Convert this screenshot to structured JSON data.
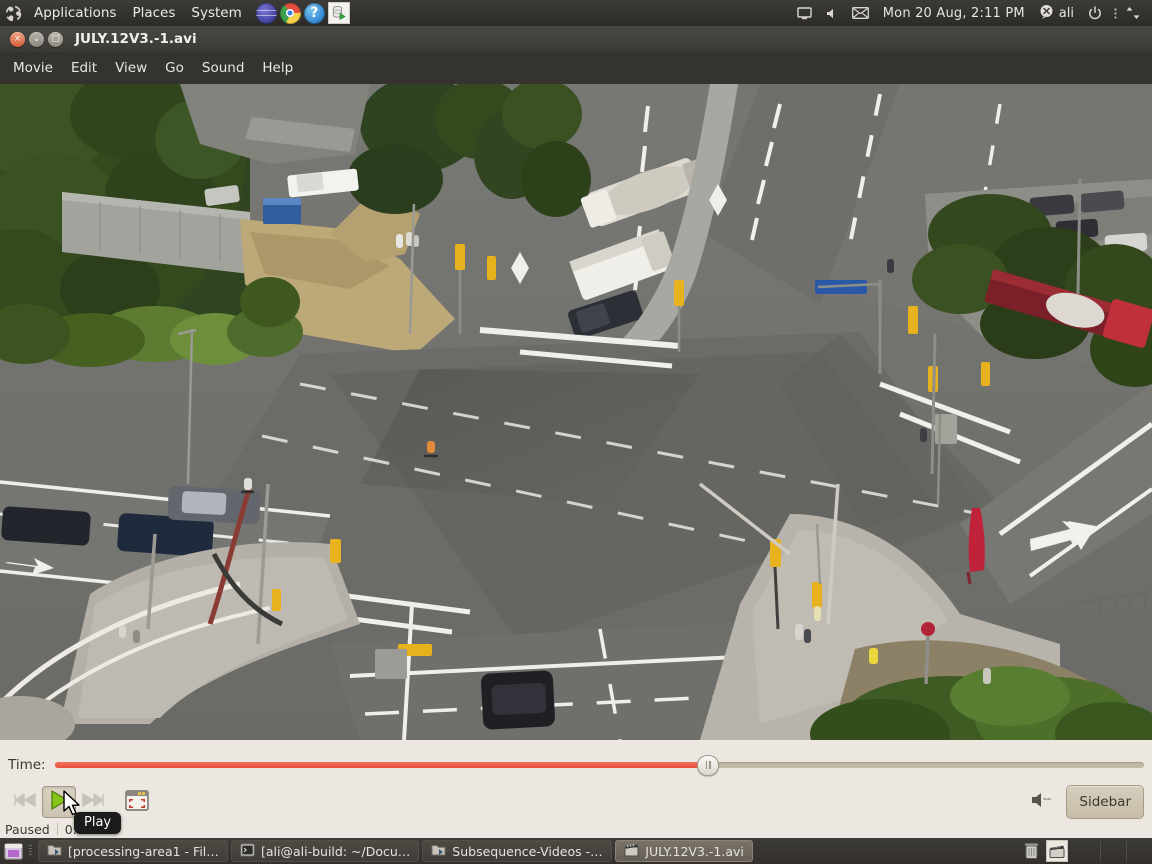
{
  "top_panel": {
    "logo_icon": "ubuntu-logo-icon",
    "menus": [
      "Applications",
      "Places",
      "System"
    ],
    "launchers": [
      {
        "name": "firefox-icon",
        "label": "Firefox"
      },
      {
        "name": "chrome-icon",
        "label": "Google Chrome"
      },
      {
        "name": "help-icon",
        "label": "Help"
      },
      {
        "name": "media-database-icon",
        "label": "Media Player"
      }
    ],
    "tray": {
      "display_icon": "display-icon",
      "volume_icon": "volume-icon",
      "mail_icon": "mail-envelope-icon",
      "clock": "Mon 20 Aug,  2:11 PM",
      "user_icon": "user-status-icon",
      "user_name": "ali",
      "power_icon": "power-icon",
      "menu_icon": "menu-dots-icon",
      "network_icon": "network-updown-icon"
    }
  },
  "window": {
    "title": "JULY.12V3.-1.avi",
    "buttons": {
      "close": "×",
      "minimize": "⌄",
      "maximize": "□"
    },
    "menu": [
      "Movie",
      "Edit",
      "View",
      "Go",
      "Sound",
      "Help"
    ]
  },
  "video": {
    "description": "Aerial view of a large urban road intersection",
    "colors": {
      "asphalt": "#6f6f6b",
      "asphalt_dark": "#5a5a57",
      "sidewalk": "#b9b5ac",
      "lane_marking": "#f2f1ec",
      "foliage_dark": "#35491f",
      "foliage_mid": "#4e6b2b",
      "foliage_light": "#76954a",
      "dry_grass": "#bda878",
      "concrete_wall": "#9a9a94",
      "traffic_light": "#e8b21f",
      "red_banner": "#c0223a"
    }
  },
  "controls": {
    "time_label": "Time:",
    "seek": {
      "progress_percent": 60,
      "fill_color": "#e8503a",
      "track_color": "#c2b9a5"
    },
    "buttons": [
      {
        "name": "previous-chapter-button",
        "icon": "skip-backward-icon",
        "enabled": false
      },
      {
        "name": "play-button",
        "icon": "play-icon",
        "enabled": true,
        "pressed": true
      },
      {
        "name": "next-chapter-button",
        "icon": "skip-forward-icon",
        "enabled": false
      },
      {
        "name": "fullscreen-button",
        "icon": "fullscreen-icon",
        "enabled": true
      }
    ],
    "volume_icon": "volume-muted-icon",
    "sidebar_label": "Sidebar",
    "tooltip": "Play"
  },
  "status": {
    "state": "Paused",
    "time": "0:0… 0"
  },
  "taskbar": {
    "show_desktop_icon": "show-desktop-icon",
    "tasks": [
      {
        "icon": "file-manager-icon",
        "label": "[processing-area1 - File…",
        "active": false
      },
      {
        "icon": "terminal-icon",
        "label": "[ali@ali-build: ~/Docu…",
        "active": false
      },
      {
        "icon": "file-manager-icon",
        "label": "Subsequence-Videos - F…",
        "active": false
      },
      {
        "icon": "movie-player-icon",
        "label": "JULY.12V3.-1.avi",
        "active": true
      }
    ],
    "tray": [
      {
        "name": "trash-icon",
        "selected": false
      },
      {
        "name": "movie-clapper-icon",
        "selected": true
      }
    ],
    "workspaces": 3
  }
}
